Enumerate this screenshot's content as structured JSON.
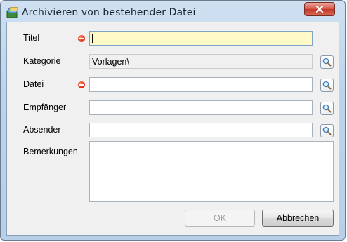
{
  "window": {
    "title": "Archivieren von bestehender Datei"
  },
  "form": {
    "titel": {
      "label": "Titel",
      "value": ""
    },
    "kategorie": {
      "label": "Kategorie",
      "value": "Vorlagen\\"
    },
    "datei": {
      "label": "Datei",
      "value": ""
    },
    "empfaenger": {
      "label": "Empfänger",
      "value": ""
    },
    "absender": {
      "label": "Absender",
      "value": ""
    },
    "bemerkungen": {
      "label": "Bemerkungen",
      "value": ""
    }
  },
  "buttons": {
    "ok": "OK",
    "cancel": "Abbrechen"
  },
  "colors": {
    "required": "#e8361a",
    "active_field": "#fff9c8",
    "close": "#c23a2a"
  }
}
